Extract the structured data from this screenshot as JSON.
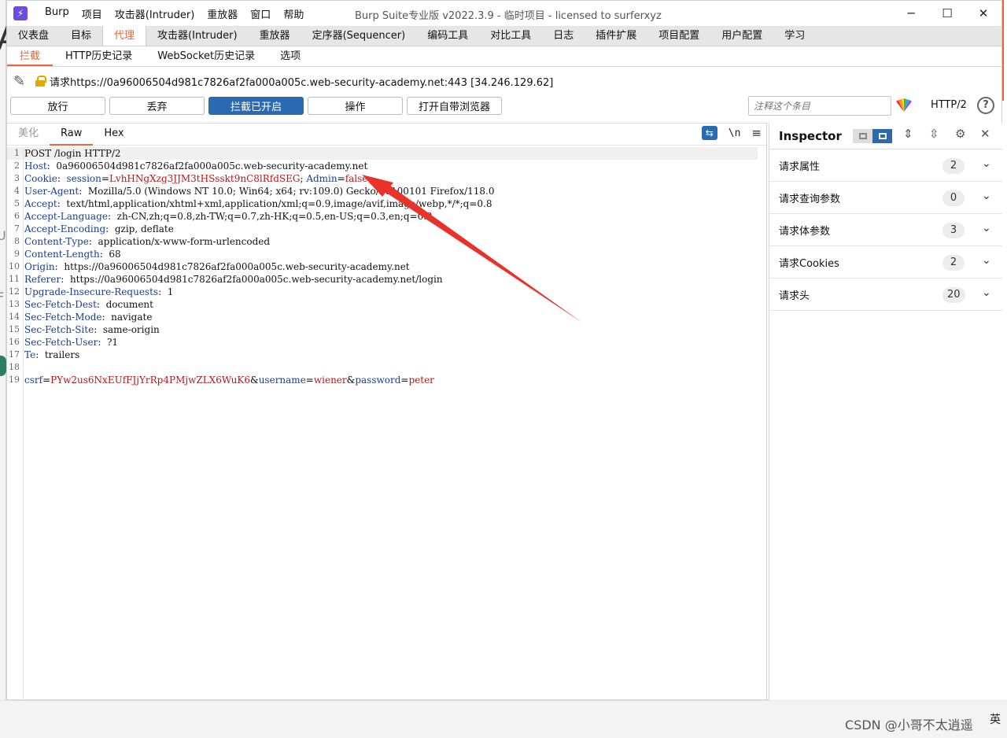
{
  "window": {
    "app_icon": "burp-lightning-icon",
    "title": "Burp Suite专业版  v2022.3.9 - 临时项目 - licensed to surferxyz",
    "menu": [
      "Burp",
      "项目",
      "攻击器(Intruder)",
      "重放器",
      "窗口",
      "帮助"
    ],
    "controls": {
      "minimize": "─",
      "maximize": "☐",
      "close": "✕"
    }
  },
  "main_tabs": [
    "仪表盘",
    "目标",
    "代理",
    "攻击器(Intruder)",
    "重放器",
    "定序器(Sequencer)",
    "编码工具",
    "对比工具",
    "日志",
    "插件扩展",
    "项目配置",
    "用户配置",
    "学习"
  ],
  "main_tab_active": "代理",
  "sub_tabs": [
    "拦截",
    "HTTP历史记录",
    "WebSocket历史记录",
    "选项"
  ],
  "sub_tab_active": "拦截",
  "request_info": "请求https://0a96006504d981c7826af2fa000a005c.web-security-academy.net:443  [34.246.129.62]",
  "toolbar": {
    "forward": "放行",
    "drop": "丢弃",
    "intercept": "拦截已开启",
    "action": "操作",
    "open_browser": "打开自带浏览器",
    "comment_placeholder": "注释这个条目",
    "protocol": "HTTP/2",
    "help": "?"
  },
  "editor_tabs": [
    "美化",
    "Raw",
    "Hex"
  ],
  "editor_tab_active": "Raw",
  "editor_icons": {
    "wrap": "⇆",
    "newline": "\\n",
    "menu": "≡"
  },
  "request_lines": [
    {
      "n": "1",
      "parts": [
        {
          "t": "POST /login HTTP/2",
          "c": "v"
        }
      ]
    },
    {
      "n": "2",
      "parts": [
        {
          "t": "Host",
          "c": "k"
        },
        {
          "t": ":  0a96006504d981c7826af2fa000a005c.web-security-academy.net",
          "c": "v"
        }
      ]
    },
    {
      "n": "3",
      "parts": [
        {
          "t": "Cookie",
          "c": "k"
        },
        {
          "t": ":  ",
          "c": "v"
        },
        {
          "t": "session",
          "c": "k"
        },
        {
          "t": "=",
          "c": "v"
        },
        {
          "t": "LvhHNgXzg3JJM3tHSsskt9nC8lRfdSEG",
          "c": "r"
        },
        {
          "t": "; ",
          "c": "v"
        },
        {
          "t": "Admin",
          "c": "k"
        },
        {
          "t": "=",
          "c": "v"
        },
        {
          "t": "false",
          "c": "r"
        }
      ]
    },
    {
      "n": "4",
      "parts": [
        {
          "t": "User-Agent",
          "c": "k"
        },
        {
          "t": ":  Mozilla/5.0 (Windows NT 10.0; Win64; x64; rv:109.0) Gecko/20100101 Firefox/118.0",
          "c": "v"
        }
      ]
    },
    {
      "n": "5",
      "parts": [
        {
          "t": "Accept",
          "c": "k"
        },
        {
          "t": ":  text/html,application/xhtml+xml,application/xml;q=0.9,image/avif,image/webp,*/*;q=0.8",
          "c": "v"
        }
      ]
    },
    {
      "n": "6",
      "parts": [
        {
          "t": "Accept-Language",
          "c": "k"
        },
        {
          "t": ":  zh-CN,zh;q=0.8,zh-TW;q=0.7,zh-HK;q=0.5,en-US;q=0.3,en;q=0.2",
          "c": "v"
        }
      ]
    },
    {
      "n": "7",
      "parts": [
        {
          "t": "Accept-Encoding",
          "c": "k"
        },
        {
          "t": ":  gzip, deflate",
          "c": "v"
        }
      ]
    },
    {
      "n": "8",
      "parts": [
        {
          "t": "Content-Type",
          "c": "k"
        },
        {
          "t": ":  application/x-www-form-urlencoded",
          "c": "v"
        }
      ]
    },
    {
      "n": "9",
      "parts": [
        {
          "t": "Content-Length",
          "c": "k"
        },
        {
          "t": ":  68",
          "c": "v"
        }
      ]
    },
    {
      "n": "10",
      "parts": [
        {
          "t": "Origin",
          "c": "k"
        },
        {
          "t": ":  https://0a96006504d981c7826af2fa000a005c.web-security-academy.net",
          "c": "v"
        }
      ]
    },
    {
      "n": "11",
      "parts": [
        {
          "t": "Referer",
          "c": "k"
        },
        {
          "t": ":  https://0a96006504d981c7826af2fa000a005c.web-security-academy.net/login",
          "c": "v"
        }
      ]
    },
    {
      "n": "12",
      "parts": [
        {
          "t": "Upgrade-Insecure-Requests",
          "c": "k"
        },
        {
          "t": ":  1",
          "c": "v"
        }
      ]
    },
    {
      "n": "13",
      "parts": [
        {
          "t": "Sec-Fetch-Dest",
          "c": "k"
        },
        {
          "t": ":  document",
          "c": "v"
        }
      ]
    },
    {
      "n": "14",
      "parts": [
        {
          "t": "Sec-Fetch-Mode",
          "c": "k"
        },
        {
          "t": ":  navigate",
          "c": "v"
        }
      ]
    },
    {
      "n": "15",
      "parts": [
        {
          "t": "Sec-Fetch-Site",
          "c": "k"
        },
        {
          "t": ":  same-origin",
          "c": "v"
        }
      ]
    },
    {
      "n": "16",
      "parts": [
        {
          "t": "Sec-Fetch-User",
          "c": "k"
        },
        {
          "t": ":  ?1",
          "c": "v"
        }
      ]
    },
    {
      "n": "17",
      "parts": [
        {
          "t": "Te",
          "c": "k"
        },
        {
          "t": ":  trailers",
          "c": "v"
        }
      ]
    },
    {
      "n": "18",
      "parts": [
        {
          "t": "",
          "c": "v"
        }
      ]
    },
    {
      "n": "19",
      "parts": [
        {
          "t": "csrf",
          "c": "k"
        },
        {
          "t": "=",
          "c": "v"
        },
        {
          "t": "PYw2us6NxEUfFJjYrRp4PMjwZLX6WuK6",
          "c": "r"
        },
        {
          "t": "&",
          "c": "v"
        },
        {
          "t": "username",
          "c": "k"
        },
        {
          "t": "=",
          "c": "v"
        },
        {
          "t": "wiener",
          "c": "r"
        },
        {
          "t": "&",
          "c": "v"
        },
        {
          "t": "password",
          "c": "k"
        },
        {
          "t": "=",
          "c": "v"
        },
        {
          "t": "peter",
          "c": "r"
        }
      ]
    }
  ],
  "inspector": {
    "title": "Inspector",
    "sections": [
      {
        "label": "请求属性",
        "count": "2"
      },
      {
        "label": "请求查询参数",
        "count": "0"
      },
      {
        "label": "请求体参数",
        "count": "3"
      },
      {
        "label": "请求Cookies",
        "count": "2"
      },
      {
        "label": "请求头",
        "count": "20"
      }
    ]
  },
  "background": {
    "glyph_a": "A",
    "glyph_u": "U",
    "glyph_f": "F"
  },
  "taskbar": {
    "watermark": "CSDN @小哥不太逍遥",
    "ime": "英"
  },
  "colors": {
    "accent": "#e8663a",
    "primary_button": "#2a6ab0",
    "header_name": "#1b3e8c",
    "value_red": "#b11a1a",
    "arrow": "#e8322a"
  }
}
